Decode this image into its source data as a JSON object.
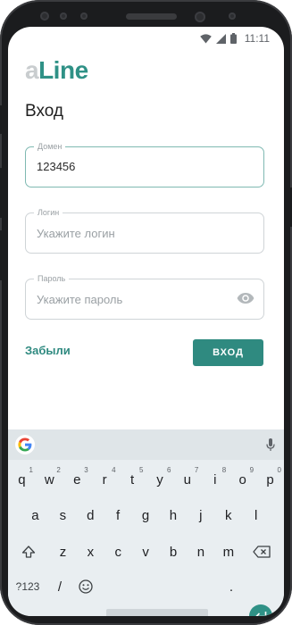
{
  "status": {
    "time": "11:11"
  },
  "logo": {
    "prefix": "a",
    "main": "Line"
  },
  "page": {
    "title": "Вход"
  },
  "form": {
    "domain": {
      "label": "Домен",
      "value": "123456"
    },
    "login": {
      "label": "Логин",
      "placeholder": "Укажите логин"
    },
    "password": {
      "label": "Пароль",
      "placeholder": "Укажите пароль"
    }
  },
  "actions": {
    "forgot": "Забыли",
    "submit": "ВХОД"
  },
  "keyboard": {
    "row1": [
      {
        "k": "q",
        "n": "1"
      },
      {
        "k": "w",
        "n": "2"
      },
      {
        "k": "e",
        "n": "3"
      },
      {
        "k": "r",
        "n": "4"
      },
      {
        "k": "t",
        "n": "5"
      },
      {
        "k": "y",
        "n": "6"
      },
      {
        "k": "u",
        "n": "7"
      },
      {
        "k": "i",
        "n": "8"
      },
      {
        "k": "o",
        "n": "9"
      },
      {
        "k": "p",
        "n": "0"
      }
    ],
    "row2": [
      "a",
      "s",
      "d",
      "f",
      "g",
      "h",
      "j",
      "k",
      "l"
    ],
    "row3": [
      "z",
      "x",
      "c",
      "v",
      "b",
      "n",
      "m"
    ],
    "symbols": "?123",
    "slash": "/",
    "period": "."
  },
  "colors": {
    "accent": "#2f8a80",
    "logo_gray": "#c9cdcf"
  }
}
